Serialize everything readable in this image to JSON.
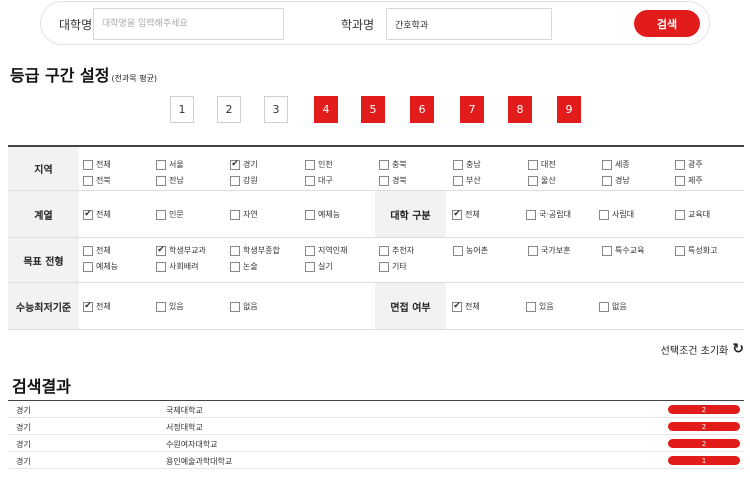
{
  "search": {
    "university_label": "대학명",
    "university_placeholder": "대학명을 입력해주세요",
    "university_value": "",
    "department_label": "학과명",
    "department_value": "간호학과",
    "search_button": "검색"
  },
  "grade": {
    "title": "등급 구간 설정",
    "subtitle": "(전과목 평균)",
    "buttons": [
      {
        "label": "1",
        "selected": false
      },
      {
        "label": "2",
        "selected": false
      },
      {
        "label": "3",
        "selected": false
      },
      {
        "label": "4",
        "selected": true
      },
      {
        "label": "5",
        "selected": true
      },
      {
        "label": "6",
        "selected": true
      },
      {
        "label": "7",
        "selected": true
      },
      {
        "label": "8",
        "selected": true
      },
      {
        "label": "9",
        "selected": true
      }
    ]
  },
  "filters": {
    "region": {
      "label": "지역",
      "options": [
        {
          "label": "전체",
          "checked": false
        },
        {
          "label": "서울",
          "checked": false
        },
        {
          "label": "경기",
          "checked": true
        },
        {
          "label": "인천",
          "checked": false
        },
        {
          "label": "충북",
          "checked": false
        },
        {
          "label": "충남",
          "checked": false
        },
        {
          "label": "대전",
          "checked": false
        },
        {
          "label": "세종",
          "checked": false
        },
        {
          "label": "광주",
          "checked": false
        },
        {
          "label": "전북",
          "checked": false
        },
        {
          "label": "전남",
          "checked": false
        },
        {
          "label": "강원",
          "checked": false
        },
        {
          "label": "대구",
          "checked": false
        },
        {
          "label": "경북",
          "checked": false
        },
        {
          "label": "부산",
          "checked": false
        },
        {
          "label": "울산",
          "checked": false
        },
        {
          "label": "경남",
          "checked": false
        },
        {
          "label": "제주",
          "checked": false
        }
      ]
    },
    "track": {
      "label": "계열",
      "options": [
        {
          "label": "전체",
          "checked": true
        },
        {
          "label": "인문",
          "checked": false
        },
        {
          "label": "자연",
          "checked": false
        },
        {
          "label": "예체능",
          "checked": false
        }
      ]
    },
    "univ_type": {
      "label": "대학 구분",
      "options": [
        {
          "label": "전체",
          "checked": true
        },
        {
          "label": "국·공립대",
          "checked": false
        },
        {
          "label": "사립대",
          "checked": false
        },
        {
          "label": "교육대",
          "checked": false
        }
      ]
    },
    "admission": {
      "label": "목표 전형",
      "options": [
        {
          "label": "전체",
          "checked": false
        },
        {
          "label": "학생부교과",
          "checked": true
        },
        {
          "label": "학생부종합",
          "checked": false
        },
        {
          "label": "지역인재",
          "checked": false
        },
        {
          "label": "추천자",
          "checked": false
        },
        {
          "label": "농어촌",
          "checked": false
        },
        {
          "label": "국가보훈",
          "checked": false
        },
        {
          "label": "특수교육",
          "checked": false
        },
        {
          "label": "특성화고",
          "checked": false
        },
        {
          "label": "예체능",
          "checked": false
        },
        {
          "label": "사회배려",
          "checked": false
        },
        {
          "label": "논술",
          "checked": false
        },
        {
          "label": "실기",
          "checked": false
        },
        {
          "label": "기타",
          "checked": false
        }
      ]
    },
    "csat_min": {
      "label": "수능최저기준",
      "options": [
        {
          "label": "전체",
          "checked": true
        },
        {
          "label": "있음",
          "checked": false
        },
        {
          "label": "없음",
          "checked": false
        }
      ]
    },
    "interview": {
      "label": "면접 여부",
      "options": [
        {
          "label": "전체",
          "checked": true
        },
        {
          "label": "있음",
          "checked": false
        },
        {
          "label": "없음",
          "checked": false
        }
      ]
    },
    "reset_label": "선택조건 초기화"
  },
  "results": {
    "title": "검색결과",
    "rows": [
      {
        "region": "경기",
        "name": "국제대학교",
        "count": "2"
      },
      {
        "region": "경기",
        "name": "서정대학교",
        "count": "2"
      },
      {
        "region": "경기",
        "name": "수원여자대학교",
        "count": "2"
      },
      {
        "region": "경기",
        "name": "용인예술과학대학교",
        "count": "1"
      }
    ]
  },
  "colors": {
    "accent": "#e21b1b",
    "header_bg": "#f2f2f2"
  }
}
